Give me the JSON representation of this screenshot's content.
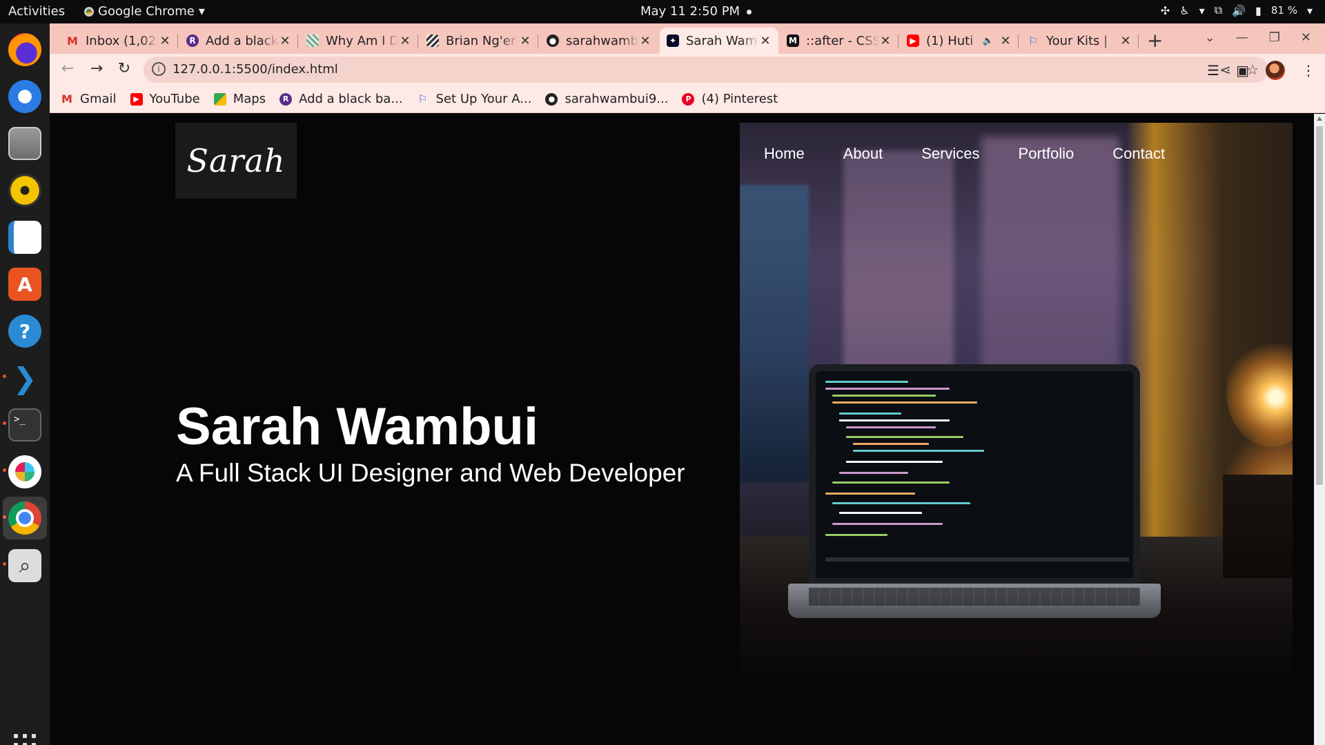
{
  "system": {
    "activities_label": "Activities",
    "app_menu_label": "Google Chrome",
    "clock": "May 11  2:50 PM",
    "battery": "81 %",
    "tray_icons": [
      "network-icon",
      "accessibility-icon",
      "wired-network-icon",
      "volume-icon",
      "battery-icon"
    ]
  },
  "dock": {
    "apps": [
      "firefox",
      "thunderbird",
      "files",
      "rhythmbox",
      "libreoffice-writer",
      "ubuntu-software",
      "help",
      "vscode",
      "terminal",
      "slack",
      "google-chrome",
      "image-viewer"
    ],
    "running_color": "#e95420"
  },
  "browser": {
    "tabs": [
      {
        "title": "Inbox (1,02",
        "favicon": "gmail-icon"
      },
      {
        "title": "Add a black",
        "favicon": "r-icon"
      },
      {
        "title": "Why Am I D",
        "favicon": "pattern-icon"
      },
      {
        "title": "Brian Ng'er",
        "favicon": "pattern-icon"
      },
      {
        "title": "sarahwamb",
        "favicon": "github-icon"
      },
      {
        "title": "Sarah Wam",
        "favicon": "site-icon",
        "active": true
      },
      {
        "title": "::after - CSS",
        "favicon": "mdn-icon"
      },
      {
        "title": "(1) Huti",
        "favicon": "youtube-icon",
        "audio": true
      },
      {
        "title": "Your Kits |",
        "favicon": "flag-icon"
      }
    ],
    "url": "127.0.0.1:5500/index.html",
    "bookmarks": [
      {
        "label": "Gmail",
        "icon": "gmail-icon"
      },
      {
        "label": "YouTube",
        "icon": "youtube-icon"
      },
      {
        "label": "Maps",
        "icon": "maps-icon"
      },
      {
        "label": "Add a black ba...",
        "icon": "r-icon"
      },
      {
        "label": "Set Up Your A...",
        "icon": "flag-icon"
      },
      {
        "label": "sarahwambui9...",
        "icon": "github-icon"
      },
      {
        "label": "(4) Pinterest",
        "icon": "pinterest-icon"
      }
    ],
    "tabstrip_color": "#f6c6bd",
    "toolbar_color": "#fde9e5"
  },
  "page": {
    "logo": "Sarah",
    "nav": [
      "Home",
      "About",
      "Services",
      "Portfolio",
      "Contact"
    ],
    "hero_name": "Sarah Wambui",
    "hero_subtitle": "A Full Stack UI Designer and Web Developer",
    "background": "#060606"
  }
}
